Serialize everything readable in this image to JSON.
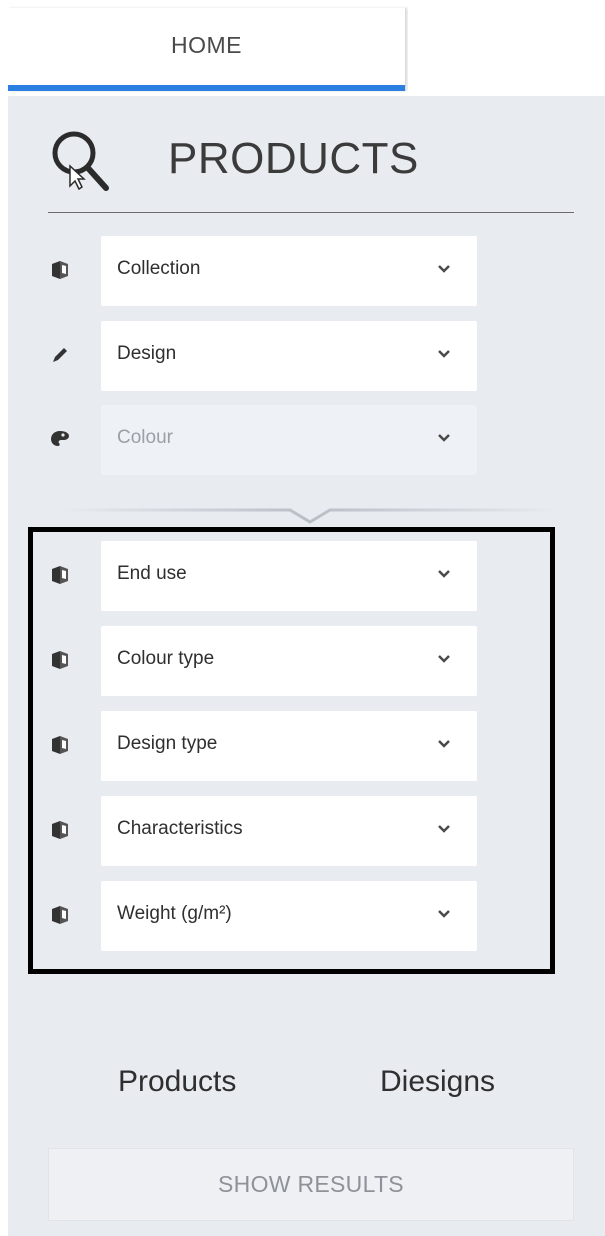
{
  "tabs": {
    "home_label": "HOME"
  },
  "header": {
    "title": "PRODUCTS"
  },
  "filters_basic": [
    {
      "label": "Collection",
      "icon": "book-icon",
      "disabled": false
    },
    {
      "label": "Design",
      "icon": "pencil-icon",
      "disabled": false
    },
    {
      "label": "Colour",
      "icon": "palette-icon",
      "disabled": true
    }
  ],
  "filters_advanced": [
    {
      "label": "End use",
      "icon": "book-icon"
    },
    {
      "label": "Colour type",
      "icon": "book-icon"
    },
    {
      "label": "Design type",
      "icon": "book-icon"
    },
    {
      "label": "Characteristics",
      "icon": "book-icon"
    },
    {
      "label": "Weight (g/m²)",
      "icon": "book-icon"
    }
  ],
  "counts": {
    "products_label": "Products",
    "designs_label": "Diesigns"
  },
  "actions": {
    "show_results_label": "SHOW RESULTS"
  },
  "colors": {
    "panel_bg": "#e8ebf0",
    "tab_accent": "#2a7fe0",
    "highlight_border": "#000000"
  }
}
